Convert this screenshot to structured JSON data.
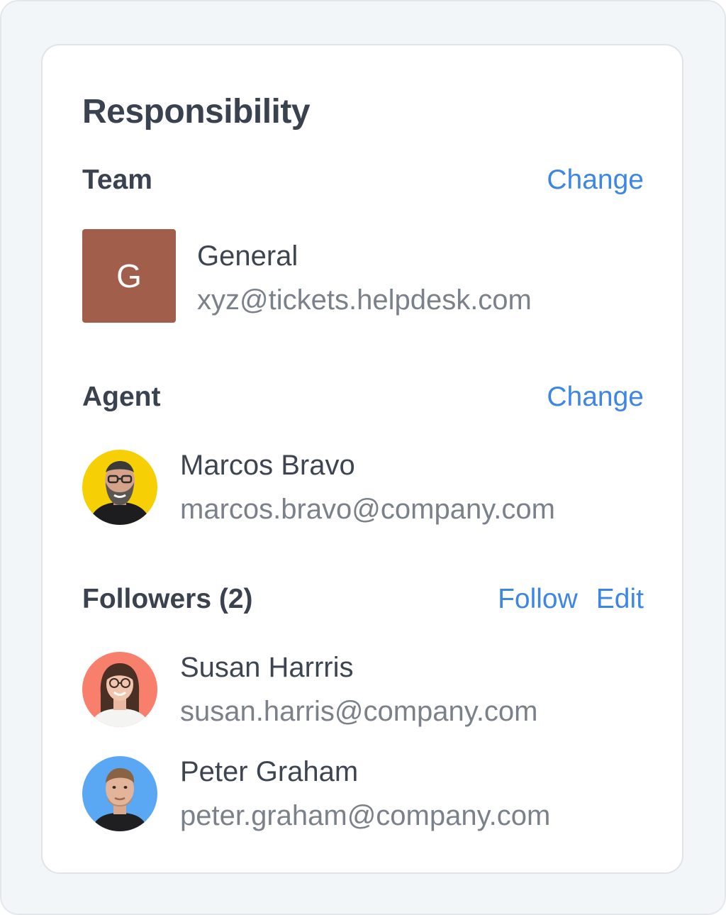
{
  "panel": {
    "title": "Responsibility"
  },
  "team": {
    "heading": "Team",
    "change_label": "Change",
    "initial": "G",
    "name": "General",
    "email": "xyz@tickets.helpdesk.com",
    "avatar_color": "#a05e4b"
  },
  "agent": {
    "heading": "Agent",
    "change_label": "Change",
    "name": "Marcos Bravo",
    "email": "marcos.bravo@company.com",
    "avatar_bg": "#f7cf05"
  },
  "followers": {
    "heading": "Followers (2)",
    "follow_label": "Follow",
    "edit_label": "Edit",
    "items": [
      {
        "name": "Susan Harrris",
        "email": "susan.harris@company.com",
        "avatar_bg": "#f77f6c"
      },
      {
        "name": "Peter Graham",
        "email": "peter.graham@company.com",
        "avatar_bg": "#5aa7f3"
      }
    ]
  },
  "colors": {
    "link": "#3d86e6",
    "heading": "#3a4250",
    "muted": "#7b818b"
  }
}
